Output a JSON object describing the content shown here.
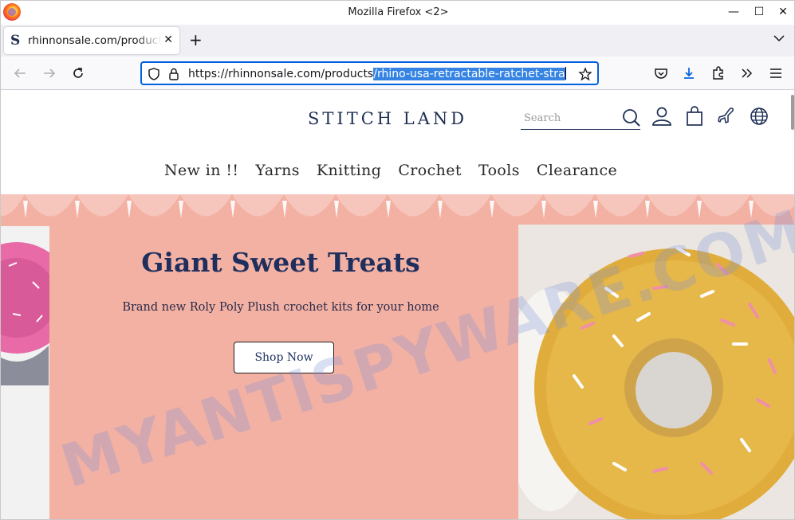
{
  "window": {
    "title": "Mozilla Firefox <2>"
  },
  "tab": {
    "title": "rhinnonsale.com/products/rhino-usa-retractable-ratchet-straps"
  },
  "url": {
    "prefix": "https://rhinnonsale.com/products",
    "selected": "/rhino-usa-retractable-ratchet-stra"
  },
  "site": {
    "brand": "STITCH LAND",
    "search_placeholder": "Search",
    "nav": [
      "New in !!",
      "Yarns",
      "Knitting",
      "Crochet",
      "Tools",
      "Clearance"
    ]
  },
  "hero": {
    "title": "Giant Sweet Treats",
    "subtitle": "Brand new Roly Poly Plush crochet kits for your home",
    "button": "Shop Now"
  },
  "watermark": "MYANTISPYWARE.COM",
  "colors": {
    "hero_bg": "#f3b1a3",
    "brand_navy": "#1e2f55",
    "url_focus": "#0061e0"
  }
}
